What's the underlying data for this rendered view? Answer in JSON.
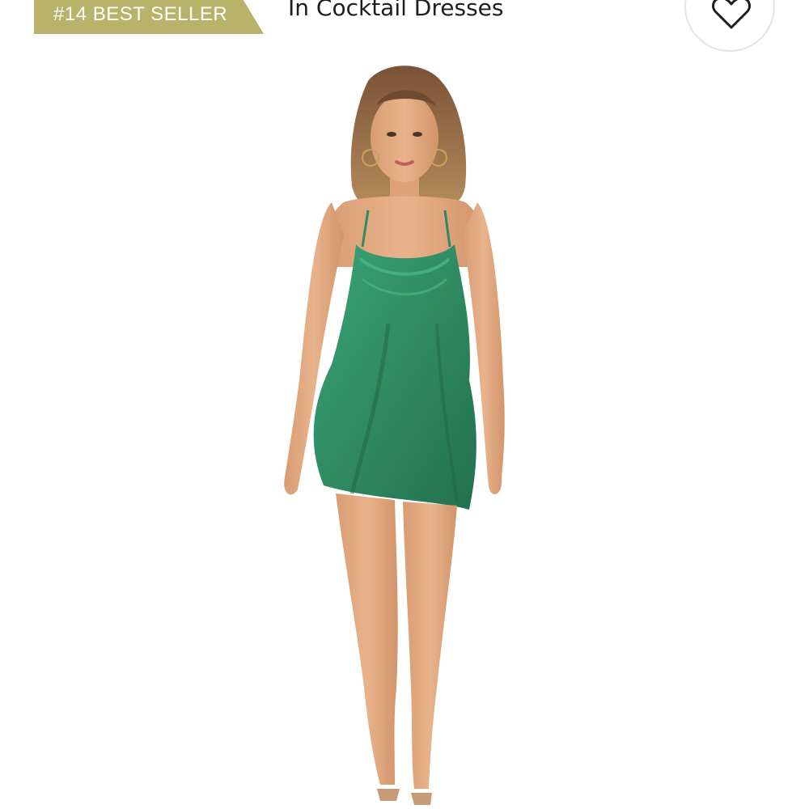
{
  "badge": {
    "label": "#14 BEST SELLER",
    "color": "#b9b26a"
  },
  "category": {
    "label": "In Cocktail Dresses"
  },
  "wishlist": {
    "icon": "heart-outline-icon"
  },
  "product": {
    "image_alt": "Model wearing green satin cowl-neck slip mini dress",
    "dress_color": "#2f8a62"
  }
}
